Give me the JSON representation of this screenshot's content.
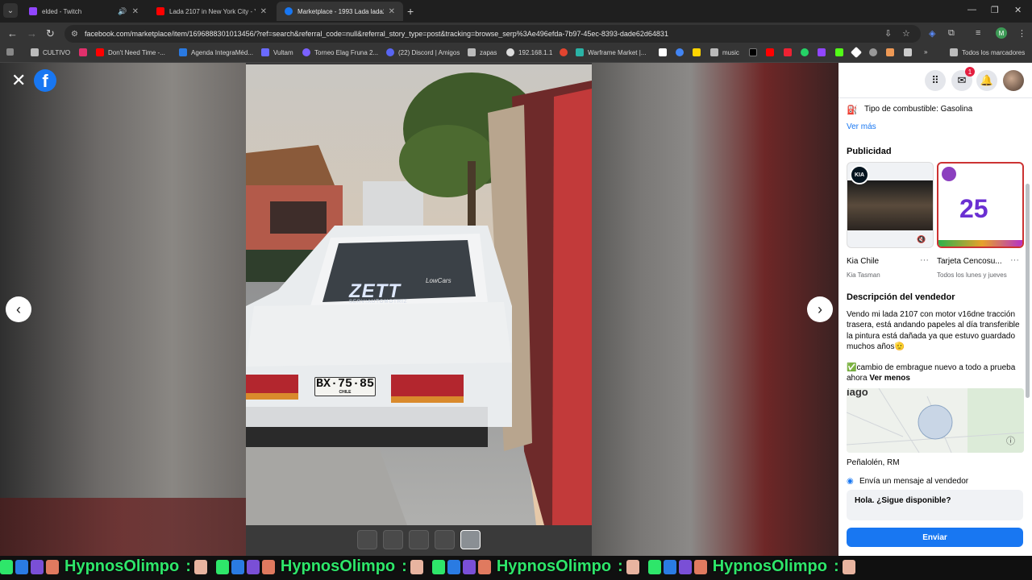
{
  "tabs": [
    {
      "title": "elded - Twitch",
      "audio": true
    },
    {
      "title": "Lada 2107 in New York City - Yo"
    },
    {
      "title": "Marketplace - 1993 Lada lada2"
    }
  ],
  "url": "facebook.com/marketplace/item/1696888301013456/?ref=search&referral_code=null&referral_story_type=post&tracking=browse_serp%3Ae496efda-7b97-45ec-8393-dade62d64831",
  "profile_initial": "M",
  "bookmarks": [
    "CULTIVO",
    "Don't Need Time -...",
    "Agenda IntegraMéd...",
    "Vultam",
    "Torneo Elag Fruna 2...",
    "(22) Discord | Amigos",
    "zapas",
    "192.168.1.1",
    "Warframe Market |...",
    "music",
    "Todos los marcadores"
  ],
  "viewer": {
    "plate": "BX·75·85",
    "plate_sub": "CHILE",
    "sticker": "ZETT",
    "sticker_sub": "SERVIAUTOMOTRIZ",
    "sticker_tag": "LowCars"
  },
  "panel": {
    "notification_count": "1",
    "fuel": "Tipo de combustible: Gasolina",
    "ver_mas": "Ver más",
    "ads_heading": "Publicidad",
    "ads": [
      {
        "name": "Kia Chile",
        "sub": "Kia Tasman",
        "logo": "KIA"
      },
      {
        "name": "Tarjeta Cencosu...",
        "sub": "Todos los lunes y jueves",
        "promo": "25"
      }
    ],
    "desc_heading": "Descripción del vendedor",
    "desc_p1": "Vendo mi lada 2107 con motor v16dne tracción trasera, está andando papeles al día transferible la pintura está dañada ya que estuvo guardado muchos años🫡",
    "desc_p2_check": "✅",
    "desc_p2": "cambio de embrague nuevo a todo a prueba ahora",
    "ver_menos": "Ver menos",
    "map_label": "iago",
    "location": "Peñalolén, RM",
    "message_label": "Envía un mensaje al vendedor",
    "message_value": "Hola. ¿Sigue disponible?",
    "send_label": "Enviar"
  },
  "overlay": {
    "text": "HypnosOlimpo",
    "sep": ":",
    "repeat_count": 4
  },
  "icons": [
    "close-icon",
    "facebook-icon",
    "chevron-left-icon",
    "chevron-right-icon",
    "grid-menu-icon",
    "messenger-icon",
    "bell-icon",
    "fuel-icon"
  ],
  "colors": {
    "facebook_blue": "#1877f2",
    "overlay_green": "#2ee66a"
  }
}
